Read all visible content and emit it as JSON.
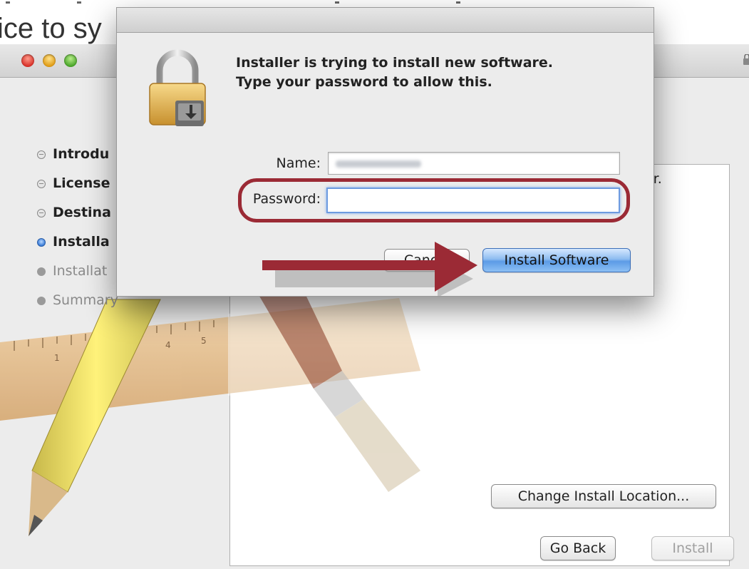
{
  "background_page": {
    "heading_fragment": "ice to sy"
  },
  "installer": {
    "steps": [
      {
        "label": "Introdu",
        "state": "done"
      },
      {
        "label": "License",
        "state": "done"
      },
      {
        "label": "Destina",
        "state": "done"
      },
      {
        "label": "Installa",
        "state": "current"
      },
      {
        "label": "Installat",
        "state": "future"
      },
      {
        "label": "Summary",
        "state": "future"
      }
    ],
    "content_text_fragment": "er.",
    "change_location_label": "Change Install Location...",
    "go_back_label": "Go Back",
    "install_label": "Install"
  },
  "auth_dialog": {
    "message_line1": "Installer is trying to install new software.",
    "message_line2": "Type your password to allow this.",
    "name_label": "Name:",
    "name_value": "",
    "password_label": "Password:",
    "password_value": "",
    "cancel_label": "Cancel",
    "install_software_label": "Install Software",
    "icon": "lock-icon"
  },
  "annotation": {
    "ring_color": "#9b2a35",
    "arrow_color": "#9b2a35"
  }
}
